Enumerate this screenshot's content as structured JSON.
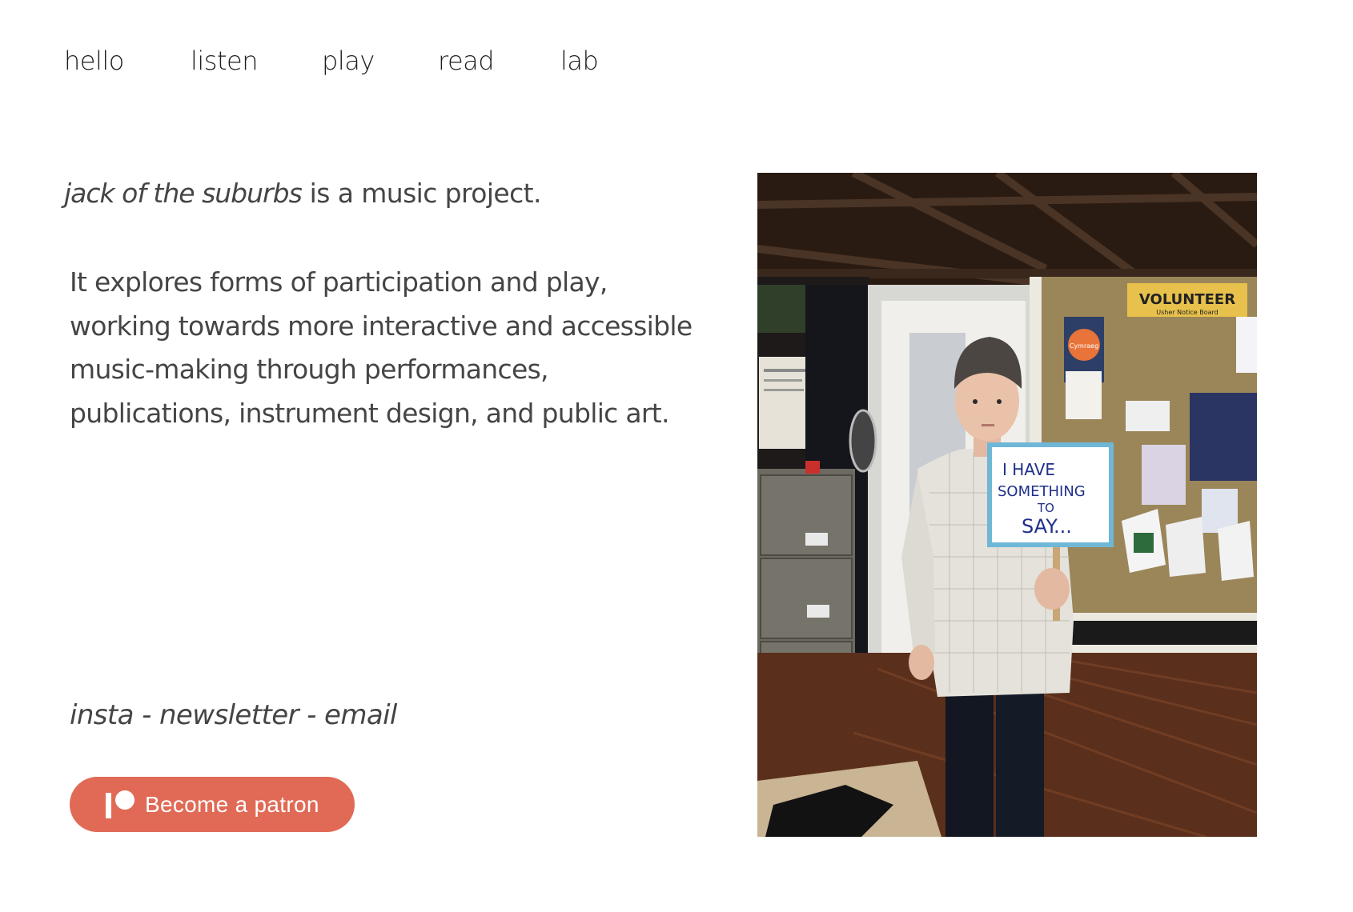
{
  "nav": {
    "items": [
      {
        "label": "hello"
      },
      {
        "label": "listen"
      },
      {
        "label": "play"
      },
      {
        "label": "read"
      },
      {
        "label": "lab"
      }
    ]
  },
  "intro": {
    "project_name": "jack of the suburbs",
    "tagline": " is a music project."
  },
  "description": {
    "lines": [
      "It explores forms of participation and play,",
      "working towards more interactive and accessible",
      "music-making through performances,",
      "publications, instrument design, and public art."
    ]
  },
  "links": {
    "insta": "insta",
    "sep1": " - ",
    "newsletter": "newsletter",
    "sep2": " - ",
    "email": "email"
  },
  "patreon": {
    "label": "Become a patron",
    "color": "#e06a56",
    "icon": "patreon-logo-icon"
  },
  "photo": {
    "sign_text": [
      "I HAVE",
      "SOMETHING",
      "TO",
      "SAY..."
    ],
    "board_title": "VOLUNTEER",
    "board_subtitle": "Usher Notice Board",
    "poster_text": "Cymraeg"
  }
}
